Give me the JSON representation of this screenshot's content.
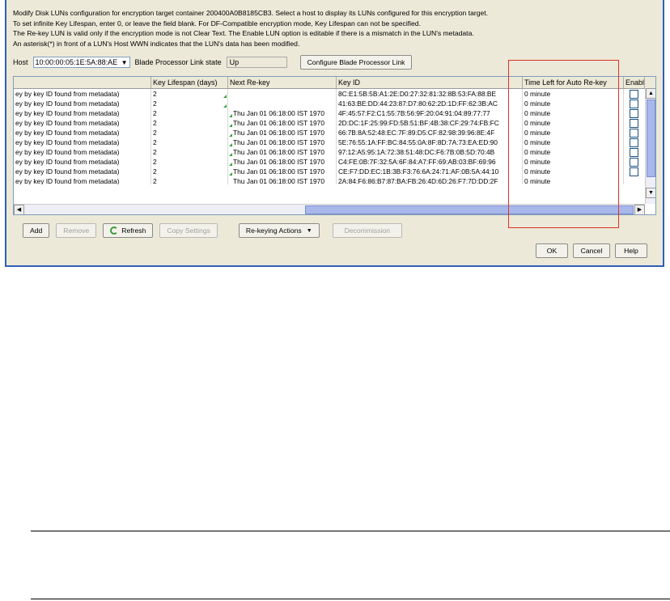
{
  "description": [
    "Modify Disk LUNs configuration for encryption target container 200400A0B8185CB3. Select a host to display its LUNs configured for this encryption target.",
    "To set infinite Key Lifespan, enter 0, or leave the field blank. For DF-Compatible encryption mode, Key Lifespan can not be specified.",
    "The Re-key LUN is valid only if the encryption mode is not Clear Text. The Enable LUN option is editable if there is a mismatch in the LUN's metadata.",
    "An asterisk(*) in front of a LUN's Host WWN indicates that the LUN's data has been modified."
  ],
  "host": {
    "label": "Host",
    "value": "10:00:00:05:1E:5A:88:AE",
    "blade_label": "Blade Processor Link state",
    "blade_value": "Up",
    "configure_button": "Configure Blade Processor Link"
  },
  "table": {
    "columns": [
      "",
      "Key Lifespan (days)",
      "Next Re-key",
      "Key ID",
      "Time Left for Auto Re-key",
      "Enable"
    ],
    "rows": [
      [
        "ey by key ID found from metadata)",
        "2",
        "",
        "8C:E1:5B:5B:A1:2E:D0:27:32:81:32:8B:53:FA:88:BE",
        "0 minute"
      ],
      [
        "ey by key ID found from metadata)",
        "2",
        "",
        "41:63:BE:DD:44:23:87:D7:80:62:2D:1D:FF:62:3B:AC",
        "0 minute"
      ],
      [
        "ey by key ID found from metadata)",
        "2",
        "Thu Jan 01 06:18:00 IST 1970",
        "4F:45:57:F2:C1:55:7B:56:9F:20:04:91:04:89:77:77",
        "0 minute"
      ],
      [
        "ey by key ID found from metadata)",
        "2",
        "Thu Jan 01 06:18:00 IST 1970",
        "2D:DC:1F:25:99:FD:5B:51:BF:4B:38:CF:29:74:FB:FC",
        "0 minute"
      ],
      [
        "ey by key ID found from metadata)",
        "2",
        "Thu Jan 01 06:18:00 IST 1970",
        "66:7B:8A:52:48:EC:7F:89:D5:CF:82:98:39:96:8E:4F",
        "0 minute"
      ],
      [
        "ey by key ID found from metadata)",
        "2",
        "Thu Jan 01 06:18:00 IST 1970",
        "5E:76:55:1A:FF:BC:84:55:0A:8F:8D:7A:73:EA:ED:90",
        "0 minute"
      ],
      [
        "ey by key ID found from metadata)",
        "2",
        "Thu Jan 01 06:18:00 IST 1970",
        "97:12:A5:95:1A:72:38:51:48:DC:F6:7B:0B:5D:70:4B",
        "0 minute"
      ],
      [
        "ey by key ID found from metadata)",
        "2",
        "Thu Jan 01 06:18:00 IST 1970",
        "C4:FE:0B:7F:32:5A:6F:84:A7:FF:69:AB:03:BF:69:96",
        "0 minute"
      ],
      [
        "ey by key ID found from metadata)",
        "2",
        "Thu Jan 01 06:18:00 IST 1970",
        "CE:F7:DD:EC:1B:3B:F3:76:6A:24:71:AF:0B:5A:44:10",
        "0 minute"
      ],
      [
        "ey by key ID found from metadata)",
        "2",
        "Thu Jan 01 06:18:00 IST 1970",
        "2A:84:F6:86:B7:87:BA:FB:26:4D:6D:26:F7:7D:DD:2F",
        "0 minute"
      ]
    ]
  },
  "buttons": {
    "add": "Add",
    "remove": "Remove",
    "refresh": "Refresh",
    "copy": "Copy Settings",
    "rekey": "Re-keying Actions",
    "decommission": "Decommission",
    "ok": "OK",
    "cancel": "Cancel",
    "help": "Help"
  },
  "colors": {
    "dialog_border": "#2f5fb8",
    "highlight": "#e0302a"
  }
}
